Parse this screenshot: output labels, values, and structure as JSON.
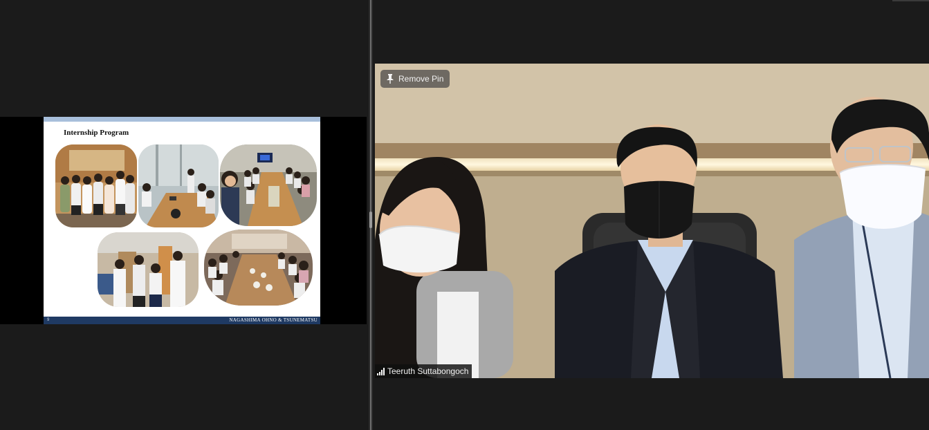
{
  "shared_screen": {
    "slide": {
      "title": "Internship Program",
      "page_number": "9",
      "brand": "NAGASHIMA OHNO & TSUNEMATSU"
    }
  },
  "video": {
    "pin_button_label": "Remove Pin",
    "participant_name": "Teeruth Suttabongoch",
    "icons": {
      "pin": "pin-icon",
      "signal": "signal-strength-icon"
    }
  },
  "colors": {
    "app_background": "#1b1b1b",
    "slide_footer": "#1f3a63",
    "slide_header_bar": "#a8bfdb"
  }
}
